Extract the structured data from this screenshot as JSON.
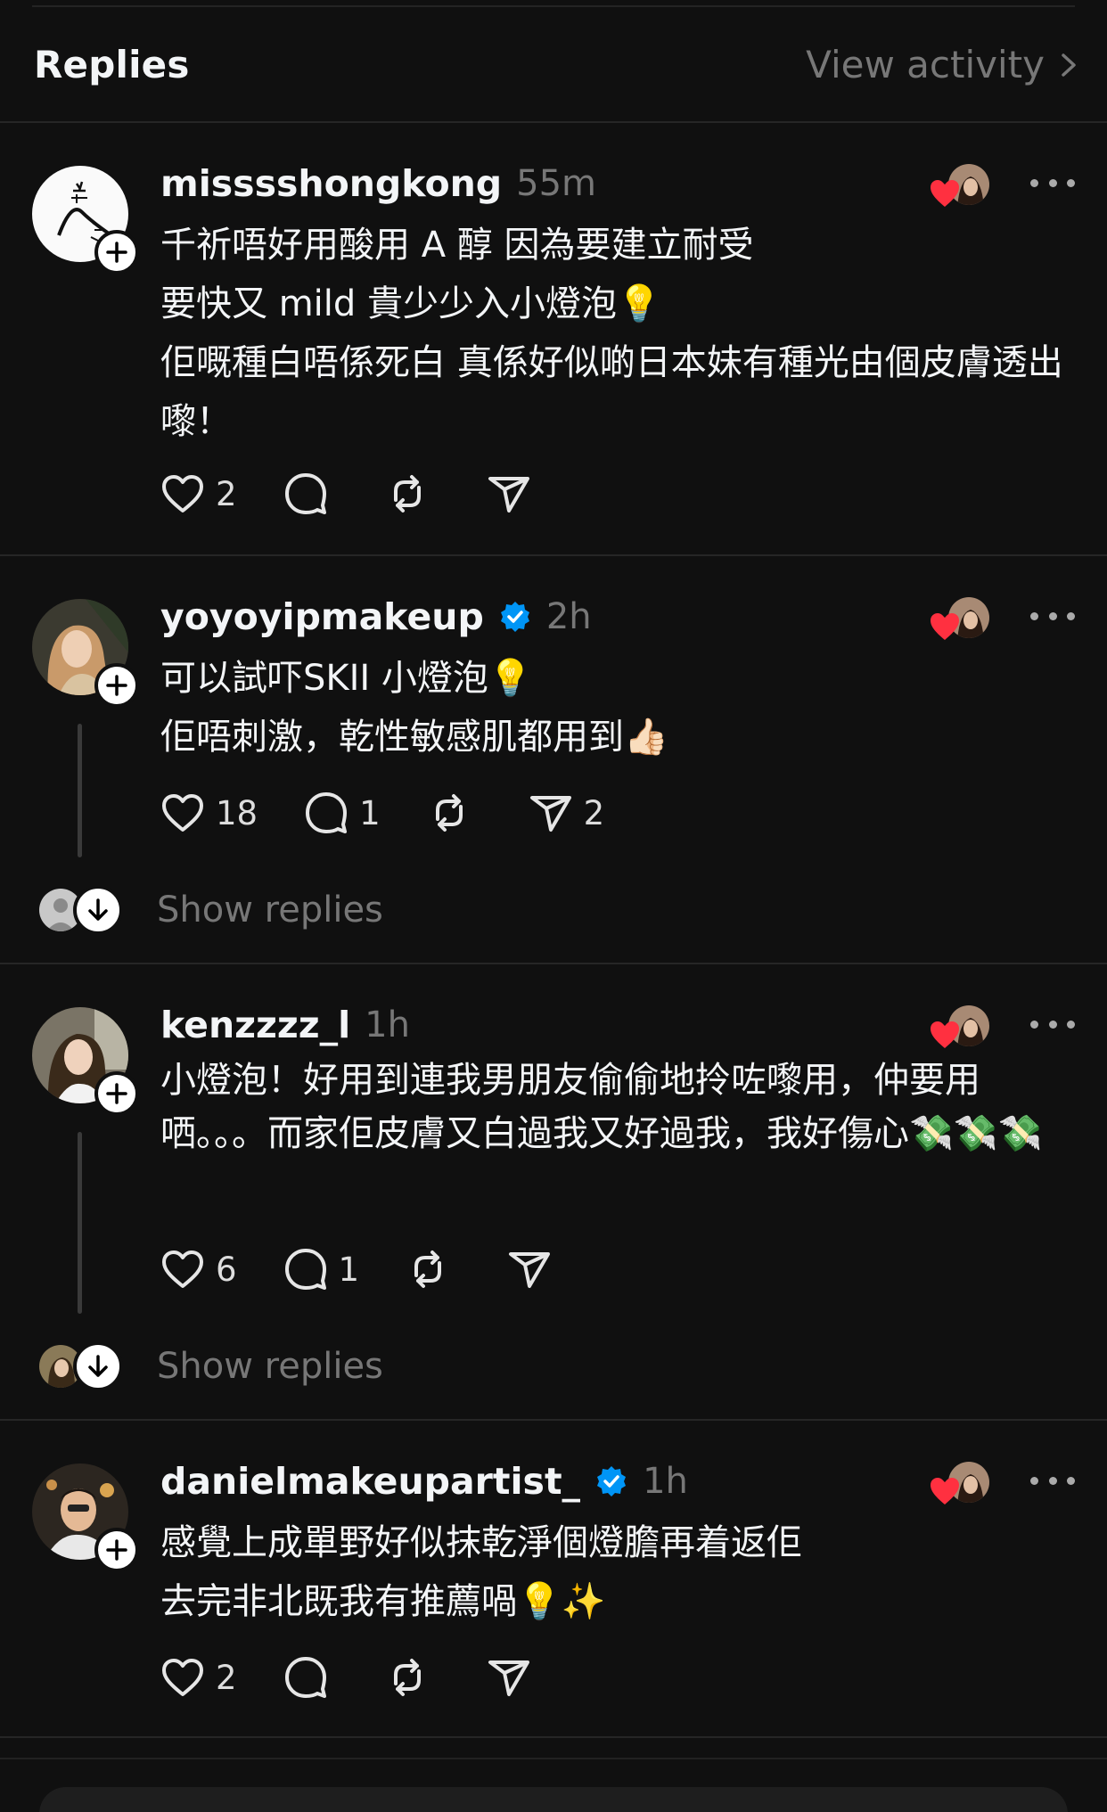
{
  "header": {
    "title": "Replies",
    "view_activity": "View activity"
  },
  "colors": {
    "background": "#101010",
    "heart_red": "#ff3040",
    "verified_blue": "#0095f6",
    "muted_text": "#777777"
  },
  "posts": [
    {
      "username": "misssshongkong",
      "time": "55m",
      "verified": false,
      "text": "千祈唔好用酸用 A 醇 因為要建立耐受\n要快又 mild 貴少少入小燈泡💡\n佢嘅種白唔係死白 真係好似啲日本妹有種光由個皮膚透出嚟！",
      "likes": "2",
      "comments": "",
      "reposts": "",
      "shares": "",
      "show_replies": ""
    },
    {
      "username": "yoyoyipmakeup",
      "time": "2h",
      "verified": true,
      "text": "可以試吓SKII 小燈泡💡\n佢唔刺激，乾性敏感肌都用到👍🏻",
      "likes": "18",
      "comments": "1",
      "reposts": "",
      "shares": "2",
      "show_replies": "Show replies"
    },
    {
      "username": "kenzzzz_l",
      "time": "1h",
      "verified": false,
      "text": "小燈泡！好用到連我男朋友偷偷地拎咗嚟用，仲要用哂。。。而家佢皮膚又白過我又好過我，我好傷心💸💸💸",
      "likes": "6",
      "comments": "1",
      "reposts": "",
      "shares": "",
      "show_replies": "Show replies"
    },
    {
      "username": "danielmakeupartist_",
      "time": "1h",
      "verified": true,
      "text": "感覺上成單野好似抹乾淨個燈膽再着返佢\n去完非北既我有推薦喎💡✨",
      "likes": "2",
      "comments": "",
      "reposts": "",
      "shares": "",
      "show_replies": ""
    }
  ],
  "icons": {
    "like": "heart-icon",
    "comment": "comment-icon",
    "repost": "repost-icon",
    "share": "share-icon",
    "more": "more-icon",
    "follow": "plus-icon",
    "chevron": "chevron-right-icon",
    "verified": "verified-icon",
    "show_replies": "arrow-down-icon"
  }
}
